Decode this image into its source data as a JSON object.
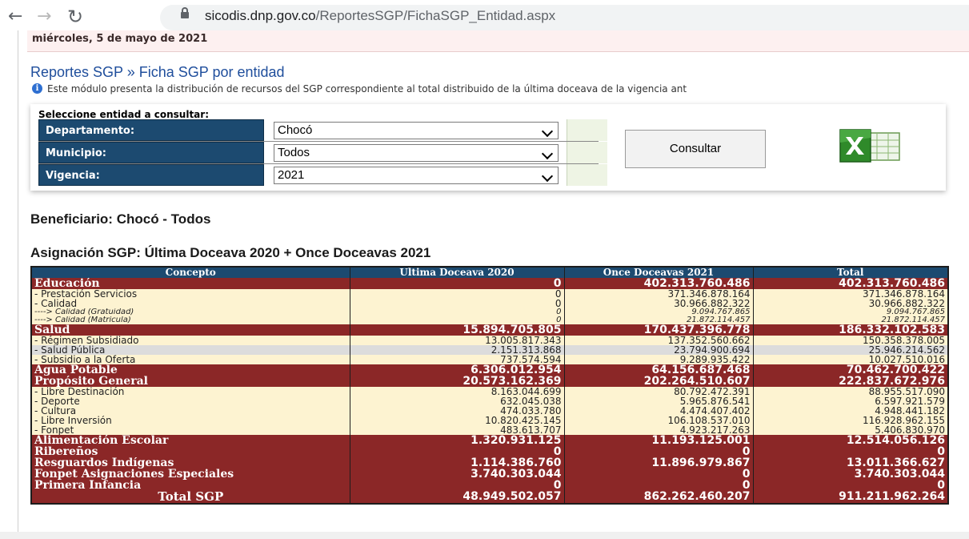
{
  "browser": {
    "url_host": "sicodis.dnp.gov.co",
    "url_path": "/ReportesSGP/FichaSGP_Entidad.aspx"
  },
  "date_text": "miércoles, 5 de mayo de 2021",
  "page_title": "Reportes SGP » Ficha SGP por entidad",
  "info_text": "Este módulo presenta la distribución de recursos del SGP correspondiente al total distribuido de la última doceava de la vigencia ant",
  "filters": {
    "title": "Seleccione entidad a consultar:",
    "departamento_label": "Departamento:",
    "departamento_value": "Chocó",
    "municipio_label": "Municipio:",
    "municipio_value": "Todos",
    "vigencia_label": "Vigencia:",
    "vigencia_value": "2021",
    "consultar_label": "Consultar",
    "icons": {
      "chevron": "chevron-down-icon",
      "export": "excel-icon"
    }
  },
  "beneficiario": "Beneficiario: Chocó - Todos",
  "asignacion_title": "Asignación SGP: Última Doceava 2020 + Once Doceavas 2021",
  "table": {
    "headers": [
      "Concepto",
      "Ultima Doceava 2020",
      "Once Doceavas 2021",
      "Total"
    ],
    "rows": [
      {
        "type": "cat",
        "concepto": "Educación",
        "ult": "0",
        "once": "402.313.760.486",
        "total": "402.313.760.486"
      },
      {
        "type": "sub",
        "concepto": "- Prestación Servicios",
        "ult": "0",
        "once": "371.346.878.164",
        "total": "371.346.878.164"
      },
      {
        "type": "sub",
        "concepto": "- Calidad",
        "ult": "0",
        "once": "30.966.882.322",
        "total": "30.966.882.322"
      },
      {
        "type": "subsub",
        "concepto": "----> Calidad (Gratuidad)",
        "ult": "0",
        "once": "9.094.767.865",
        "total": "9.094.767.865"
      },
      {
        "type": "subsub",
        "concepto": "----> Calidad (Matrícula)",
        "ult": "0",
        "once": "21.872.114.457",
        "total": "21.872.114.457"
      },
      {
        "type": "cat",
        "concepto": "Salud",
        "ult": "15.894.705.805",
        "once": "170.437.396.778",
        "total": "186.332.102.583"
      },
      {
        "type": "sub",
        "concepto": "- Régimen Subsidiado",
        "ult": "13.005.817.343",
        "once": "137.352.560.662",
        "total": "150.358.378.005"
      },
      {
        "type": "sub hl",
        "concepto": "- Salud Pública",
        "ult": "2.151.313.868",
        "once": "23.794.900.694",
        "total": "25.946.214.562"
      },
      {
        "type": "sub",
        "concepto": "- Subsidio a la Oferta",
        "ult": "737.574.594",
        "once": "9.289.935.422",
        "total": "10.027.510.016"
      },
      {
        "type": "cat",
        "concepto": "Agua Potable",
        "ult": "6.306.012.954",
        "once": "64.156.687.468",
        "total": "70.462.700.422"
      },
      {
        "type": "cat",
        "concepto": "Propósito General",
        "ult": "20.573.162.369",
        "once": "202.264.510.607",
        "total": "222.837.672.976"
      },
      {
        "type": "sub",
        "concepto": "- Libre Destinación",
        "ult": "8.163.044.699",
        "once": "80.792.472.391",
        "total": "88.955.517.090"
      },
      {
        "type": "sub",
        "concepto": "- Deporte",
        "ult": "632.045.038",
        "once": "5.965.876.541",
        "total": "6.597.921.579"
      },
      {
        "type": "sub",
        "concepto": "- Cultura",
        "ult": "474.033.780",
        "once": "4.474.407.402",
        "total": "4.948.441.182"
      },
      {
        "type": "sub",
        "concepto": "- Libre Inversión",
        "ult": "10.820.425.145",
        "once": "106.108.537.010",
        "total": "116.928.962.155"
      },
      {
        "type": "sub",
        "concepto": "- Fonpet",
        "ult": "483.613.707",
        "once": "4.923.217.263",
        "total": "5.406.830.970"
      },
      {
        "type": "cat",
        "concepto": "Alimentación Escolar",
        "ult": "1.320.931.125",
        "once": "11.193.125.001",
        "total": "12.514.056.126"
      },
      {
        "type": "cat",
        "concepto": "Ribereños",
        "ult": "0",
        "once": "0",
        "total": "0"
      },
      {
        "type": "cat",
        "concepto": "Resguardos Indígenas",
        "ult": "1.114.386.760",
        "once": "11.896.979.867",
        "total": "13.011.366.627"
      },
      {
        "type": "cat",
        "concepto": "Fonpet Asignaciones Especiales",
        "ult": "3.740.303.044",
        "once": "0",
        "total": "3.740.303.044"
      },
      {
        "type": "cat",
        "concepto": "Primera Infancia",
        "ult": "0",
        "once": "0",
        "total": "0"
      },
      {
        "type": "total",
        "concepto": "Total SGP",
        "ult": "48.949.502.057",
        "once": "862.262.460.207",
        "total": "911.211.962.264"
      }
    ]
  },
  "colors": {
    "header_blue": "#1c4a70",
    "category_red": "#8b2727",
    "sub_yellow": "#fdf3d1",
    "title_blue": "#1f4e9c"
  }
}
